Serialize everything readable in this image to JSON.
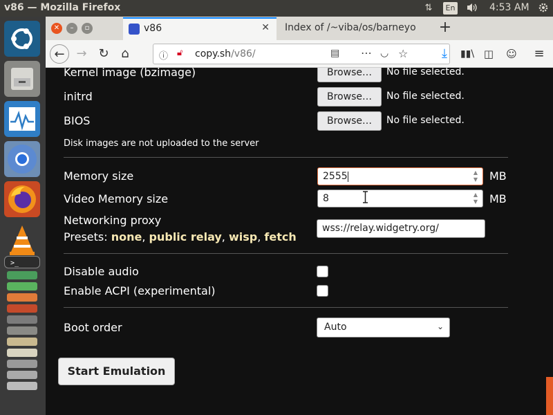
{
  "system": {
    "window_title": "v86 — Mozilla Firefox",
    "keyboard_layout": "En",
    "clock": "4:53 AM",
    "icons": [
      "network-icon",
      "volume-icon",
      "settings-gear-icon"
    ]
  },
  "launcher": {
    "items": [
      "ubuntu-dash-icon",
      "files-icon",
      "system-monitor-icon",
      "chromium-icon",
      "firefox-icon",
      "vlc-icon",
      "terminal-icon"
    ]
  },
  "browser": {
    "tabs": [
      {
        "label": "v86",
        "active": true
      },
      {
        "label": "Index of /~viba/os/barneyo",
        "active": false
      }
    ],
    "url": {
      "domain": "copy.sh",
      "path": "/v86/"
    }
  },
  "form": {
    "files": [
      {
        "label": "Kernel image (bzimage)",
        "button": "Browse…",
        "status": "No file selected."
      },
      {
        "label": "initrd",
        "button": "Browse…",
        "status": "No file selected."
      },
      {
        "label": "BIOS",
        "button": "Browse…",
        "status": "No file selected."
      }
    ],
    "disk_note": "Disk images are not uploaded to the server",
    "memory": {
      "label": "Memory size",
      "value": "2555",
      "unit": "MB"
    },
    "video_memory": {
      "label": "Video Memory size",
      "value": "8",
      "unit": "MB"
    },
    "proxy": {
      "label": "Networking proxy",
      "presets_label": "Presets:",
      "presets": [
        "none",
        "public relay",
        "wisp",
        "fetch"
      ],
      "value": "wss://relay.widgetry.org/"
    },
    "disable_audio": {
      "label": "Disable audio",
      "checked": false
    },
    "enable_acpi": {
      "label": "Enable ACPI (experimental)",
      "checked": false
    },
    "boot_order": {
      "label": "Boot order",
      "selected": "Auto"
    },
    "start_button": "Start Emulation"
  }
}
